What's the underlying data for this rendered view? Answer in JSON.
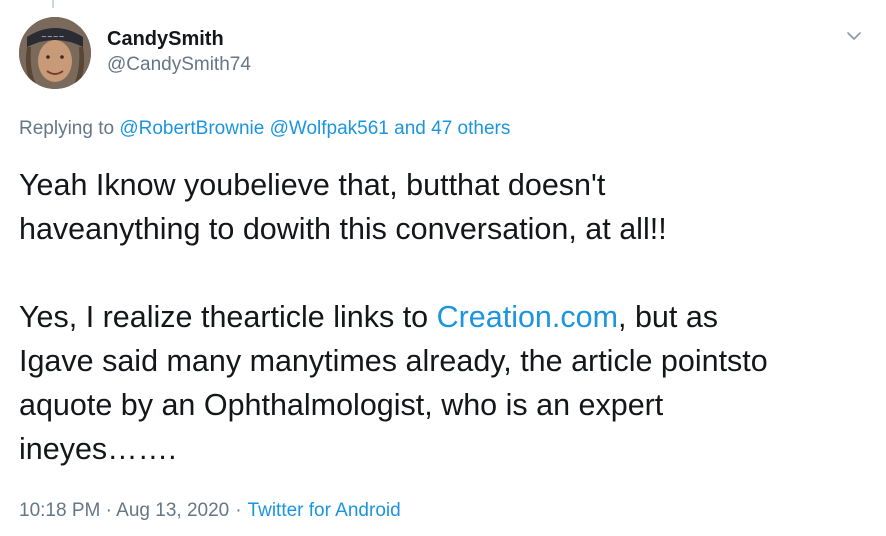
{
  "tweet": {
    "author": {
      "display_name": "CandySmith",
      "handle": "@CandySmith74",
      "avatar_icon": "user-avatar"
    },
    "menu_icon": "chevron-down-icon",
    "replying": {
      "prefix": "Replying to",
      "mentions": [
        "@RobertBrownie",
        "@Wolfpak561"
      ],
      "others": "and 47 others"
    },
    "text": {
      "para1": "Yeah Iknow youbelieve that, butthat doesn't\nhaveanything to dowith this conversation, at all!!",
      "para2_before": "Yes, I realize thearticle links to ",
      "para2_link": "Creation.com",
      "para2_after": ", but as\nIgave said many manytimes already, the article pointsto\naquote by an Ophthalmologist, who is an expert\nineyes……."
    },
    "timestamp": "10:18 PM · Aug 13, 2020",
    "separator": "·",
    "source": "Twitter for Android",
    "colors": {
      "link": "#1b95e0",
      "secondary_text": "#657786",
      "primary_text": "#14171a"
    }
  }
}
